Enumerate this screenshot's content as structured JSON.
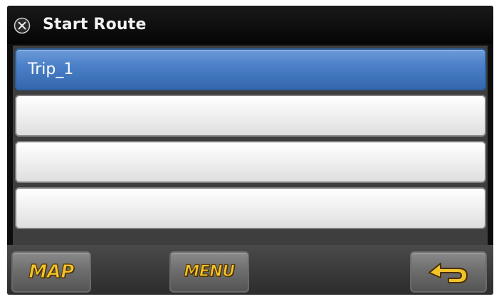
{
  "window": {
    "title": "Start Route",
    "title_icon": "close-icon"
  },
  "routes": [
    {
      "label": "Trip_1",
      "selected": true
    },
    {
      "label": "",
      "selected": false
    },
    {
      "label": "",
      "selected": false
    },
    {
      "label": "",
      "selected": false
    }
  ],
  "toolbar": {
    "map_label": "MAP",
    "menu_label": "MENU",
    "back_icon": "back-arrow-icon"
  },
  "colors": {
    "selected_row": "#4b80c8",
    "button_text": "#f2c42c",
    "title_bar": "#0d0d0d"
  }
}
